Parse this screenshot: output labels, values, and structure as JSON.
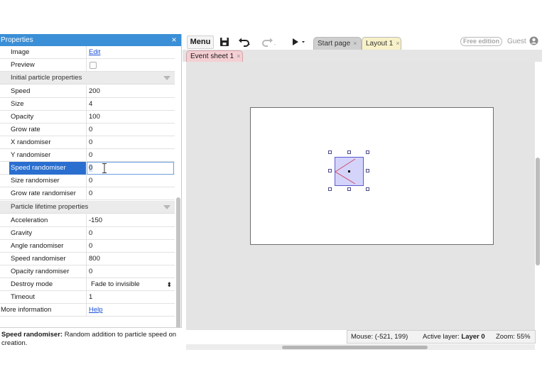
{
  "properties_panel": {
    "title": "Properties",
    "rows": [
      {
        "name": "Image",
        "value": "Edit",
        "kind": "link"
      },
      {
        "name": "Preview",
        "value": "",
        "kind": "checkbox"
      },
      {
        "name": "Initial particle properties",
        "kind": "section"
      },
      {
        "name": "Speed",
        "value": "200"
      },
      {
        "name": "Size",
        "value": "4"
      },
      {
        "name": "Opacity",
        "value": "100"
      },
      {
        "name": "Grow rate",
        "value": "0"
      },
      {
        "name": "X randomiser",
        "value": "0"
      },
      {
        "name": "Y randomiser",
        "value": "0"
      },
      {
        "name": "Speed randomiser",
        "value": "0",
        "kind": "editing"
      },
      {
        "name": "Size randomiser",
        "value": "0"
      },
      {
        "name": "Grow rate randomiser",
        "value": "0"
      },
      {
        "name": "Particle lifetime properties",
        "kind": "section"
      },
      {
        "name": "Acceleration",
        "value": "-150"
      },
      {
        "name": "Gravity",
        "value": "0"
      },
      {
        "name": "Angle randomiser",
        "value": "0"
      },
      {
        "name": "Speed randomiser",
        "value": "800"
      },
      {
        "name": "Opacity randomiser",
        "value": "0"
      },
      {
        "name": "Destroy mode",
        "value": "Fade to invisible",
        "kind": "select"
      },
      {
        "name": "Timeout",
        "value": "1"
      },
      {
        "name": "More information",
        "value": "Help",
        "kind": "link-flush"
      }
    ],
    "description": {
      "bold": "Speed randomiser:",
      "text": " Random addition to particle speed on creation."
    }
  },
  "toolbar": {
    "menu_label": "Menu",
    "tabs": [
      {
        "label": "Start page",
        "close": "×"
      },
      {
        "label": "Layout 1",
        "close": "×"
      }
    ],
    "edition_badge": "Free edition",
    "user_label": "Guest"
  },
  "subtabs": {
    "event_sheet": {
      "label": "Event sheet 1",
      "close": "×"
    }
  },
  "status": {
    "mouse": "Mouse: (-521, 199)",
    "active_layer_label": "Active layer: ",
    "active_layer_value": "Layer 0",
    "zoom": "Zoom: 55%"
  },
  "colors": {
    "panel_header": "#3b8fd6",
    "selection": "#2a6fd0",
    "layout_tab": "#f8f1c8",
    "event_tab": "#f4cfd3",
    "object_fill": "#d4d4fb"
  }
}
